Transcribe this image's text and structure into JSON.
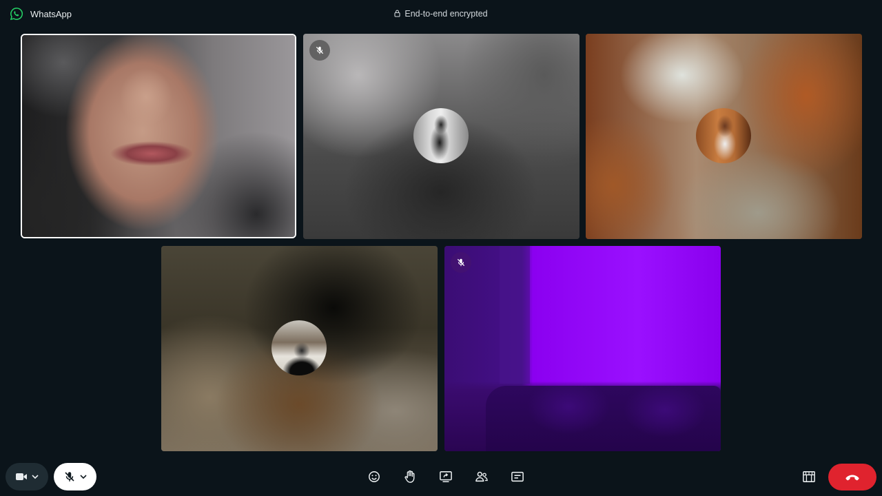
{
  "app": {
    "title": "WhatsApp",
    "encryption_label": "End-to-end encrypted"
  },
  "colors": {
    "brand": "#25D366",
    "background": "#0b141a",
    "end_call": "#e0232e",
    "self_tile_border": "#ffffff"
  },
  "tiles": [
    {
      "participant": "self",
      "view": "live-video",
      "muted": false
    },
    {
      "participant": "participant-2",
      "view": "avatar-blurred-background",
      "muted": true
    },
    {
      "participant": "participant-3",
      "view": "avatar-blurred-background",
      "muted": false
    },
    {
      "participant": "participant-4",
      "view": "avatar-blurred-background",
      "muted": false
    },
    {
      "participant": "participant-5",
      "view": "live-video",
      "muted": true
    }
  ],
  "controls": {
    "left": [
      {
        "name": "camera-toggle",
        "icon": "video-camera-icon",
        "has_dropdown": true
      },
      {
        "name": "microphone-toggle",
        "icon": "microphone-off-icon",
        "has_dropdown": true,
        "state": "muted"
      }
    ],
    "center": [
      {
        "name": "reactions",
        "icon": "smiley-icon"
      },
      {
        "name": "raise-hand",
        "icon": "hand-icon"
      },
      {
        "name": "share-screen",
        "icon": "share-screen-icon"
      },
      {
        "name": "participants",
        "icon": "people-icon"
      },
      {
        "name": "captions",
        "icon": "captions-icon"
      }
    ],
    "right": [
      {
        "name": "layout",
        "icon": "layout-icon"
      },
      {
        "name": "end-call",
        "icon": "phone-hangup-icon"
      }
    ]
  }
}
